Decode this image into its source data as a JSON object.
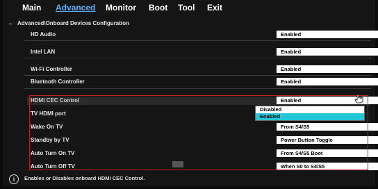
{
  "menu": {
    "items": [
      {
        "label": "Main",
        "active": false
      },
      {
        "label": "Advanced",
        "active": true
      },
      {
        "label": "Monitor",
        "active": false
      },
      {
        "label": "Boot",
        "active": false
      },
      {
        "label": "Tool",
        "active": false
      },
      {
        "label": "Exit",
        "active": false
      }
    ]
  },
  "breadcrumb": {
    "back_icon": "back-arrow-icon",
    "path": "Advanced\\Onboard Devices Configuration"
  },
  "settings": [
    {
      "label": "HD Audio",
      "value": "Enabled"
    },
    {
      "label": "Intel LAN",
      "value": "Enabled"
    },
    {
      "label": "Wi-Fi Controller",
      "value": "Enabled"
    },
    {
      "label": "Bluetooth Controller",
      "value": "Enabled"
    },
    {
      "label": "HDMI CEC Control",
      "value": "Enabled"
    },
    {
      "label": "TV HDMI port",
      "value": ""
    },
    {
      "label": "Wake On TV",
      "value": "From S4/S5"
    },
    {
      "label": "Standby by TV",
      "value": "Power Button Toggle"
    },
    {
      "label": "Auto Turn On TV",
      "value": "From S4/S5 Boot"
    },
    {
      "label": "Auto Turn Off TV",
      "value": "When S0 to S4/S5"
    }
  ],
  "open_dropdown": {
    "options": [
      "Disabled",
      "Enabled"
    ],
    "selected": "Enabled"
  },
  "footer": {
    "icon": "info-icon",
    "help": "Enables or Disables onboard HDMI CEC Control."
  },
  "colors": {
    "accent": "#5fb0ff",
    "selection": "#22c7d6",
    "focus_border": "#c02020"
  }
}
